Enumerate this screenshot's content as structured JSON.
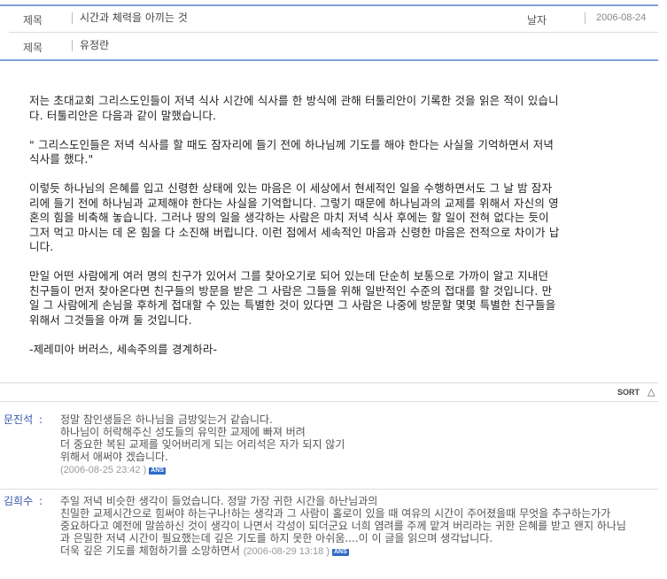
{
  "header": {
    "title_label": "제목",
    "title_value": "시간과 체력을 아끼는 것",
    "date_label": "날자",
    "date_value": "2006-08-24",
    "author_label": "제목",
    "author_value": "유정란"
  },
  "article": {
    "paragraphs": [
      "저는 초대교회 그리스도인들이 저녁 식사 시간에 식사를 한 방식에 관해 터툴리안이 기록한 것을 읽은 적이 있습니\n다. 터툴리안은 다음과 같이 말했습니다.",
      "\" 그리스도인들은 저녁 식사를 할 때도 잠자리에 들기 전에 하나님께 기도를 해야 한다는 사실을 기억하면서 저녁\n식사를 했다.\"",
      "이렇듯 하나님의 은혜를 입고 신령한 상태에 있는 마음은 이 세상에서 현세적인 일을 수행하면서도 그 날 밤 잠자\n리에 들기 전에 하나님과 교제해야 한다는 사실을 기억합니다. 그렇기 때문에 하나님과의 교제를 위해서 자신의 영\n혼의 힘을 비축해 놓습니다. 그러나 땅의 일을 생각하는 사람은 마치 저녁 식사 후에는 할 일이 전혀 없다는 듯이\n그저 먹고 마시는 데 온 힘을 다 소진해 버립니다. 이런 점에서 세속적인 마음과 신령한 마음은 전적으로 차이가 납\n니다.",
      "만일 어떤 사람에게 여러 명의 친구가 있어서 그를 찾아오기로 되어 있는데 단순히 보통으로 가까이 알고 지내던\n친구들이 먼저 찾아온다면 친구들의 방문을 받은 그 사람은 그들을 위해 일반적인 수준의 접대를 할 것입니다. 만\n일 그 사람에게 손님을 후하게 접대할 수 있는 특별한 것이 있다면 그 사람은 나중에 방문할 몇몇 특별한 친구들을\n위해서 그것들을 아껴 둘 것입니다.",
      "-제레미아 버러스, 세속주의를 경계하라-"
    ]
  },
  "sort": {
    "label": "SORT",
    "icon": "triangle-up-icon"
  },
  "comments": [
    {
      "author": "문진석",
      "colon": ":",
      "body": "정말 참인생들은 하나님을 금방잊는거 같습니다.\n하나님이 허락해주신 성도들의 유익한 교제에 빠져 버려\n더 중요한 복된 교제를 잊어버리게 되는 어리석은 자가 되지 않기\n위해서 애써야 겠습니다.",
      "timestamp": "(2006-08-25 23:42 )",
      "badge": "ANS"
    },
    {
      "author": "김희수",
      "colon": ":",
      "body": "주일 저녁 비슷한 생각이 들었습니다. 정말 가장 귀한 시간을 하난님과의\n친밀한 교제시간으로 힘써야 하는구나!하는 생각과 그 사람이 홀로이 있을 때 여유의 시간이 주어졌을때 무엇을 추구하는가가\n중요하다고 예전에 말씀하신 것이 생각이 나면서 각성이 되더군요 너희 염려를 주께 맡겨 버리라는 귀한 은혜를 받고 왠지 하나님\n과 은밀한 저녁 시간이 필요했는데 깊은 기도를 하지 못한 아쉬움....이 이 글을 읽으며 생각납니다.\n더욱 깊은 기도를 체험하기를 소망하면서 ",
      "timestamp": "(2006-08-29 13:18 )",
      "badge": "ANS"
    }
  ],
  "colors": {
    "accent": "#7f9fd8",
    "author": "#3355aa",
    "badge": "#2e6bc6"
  }
}
